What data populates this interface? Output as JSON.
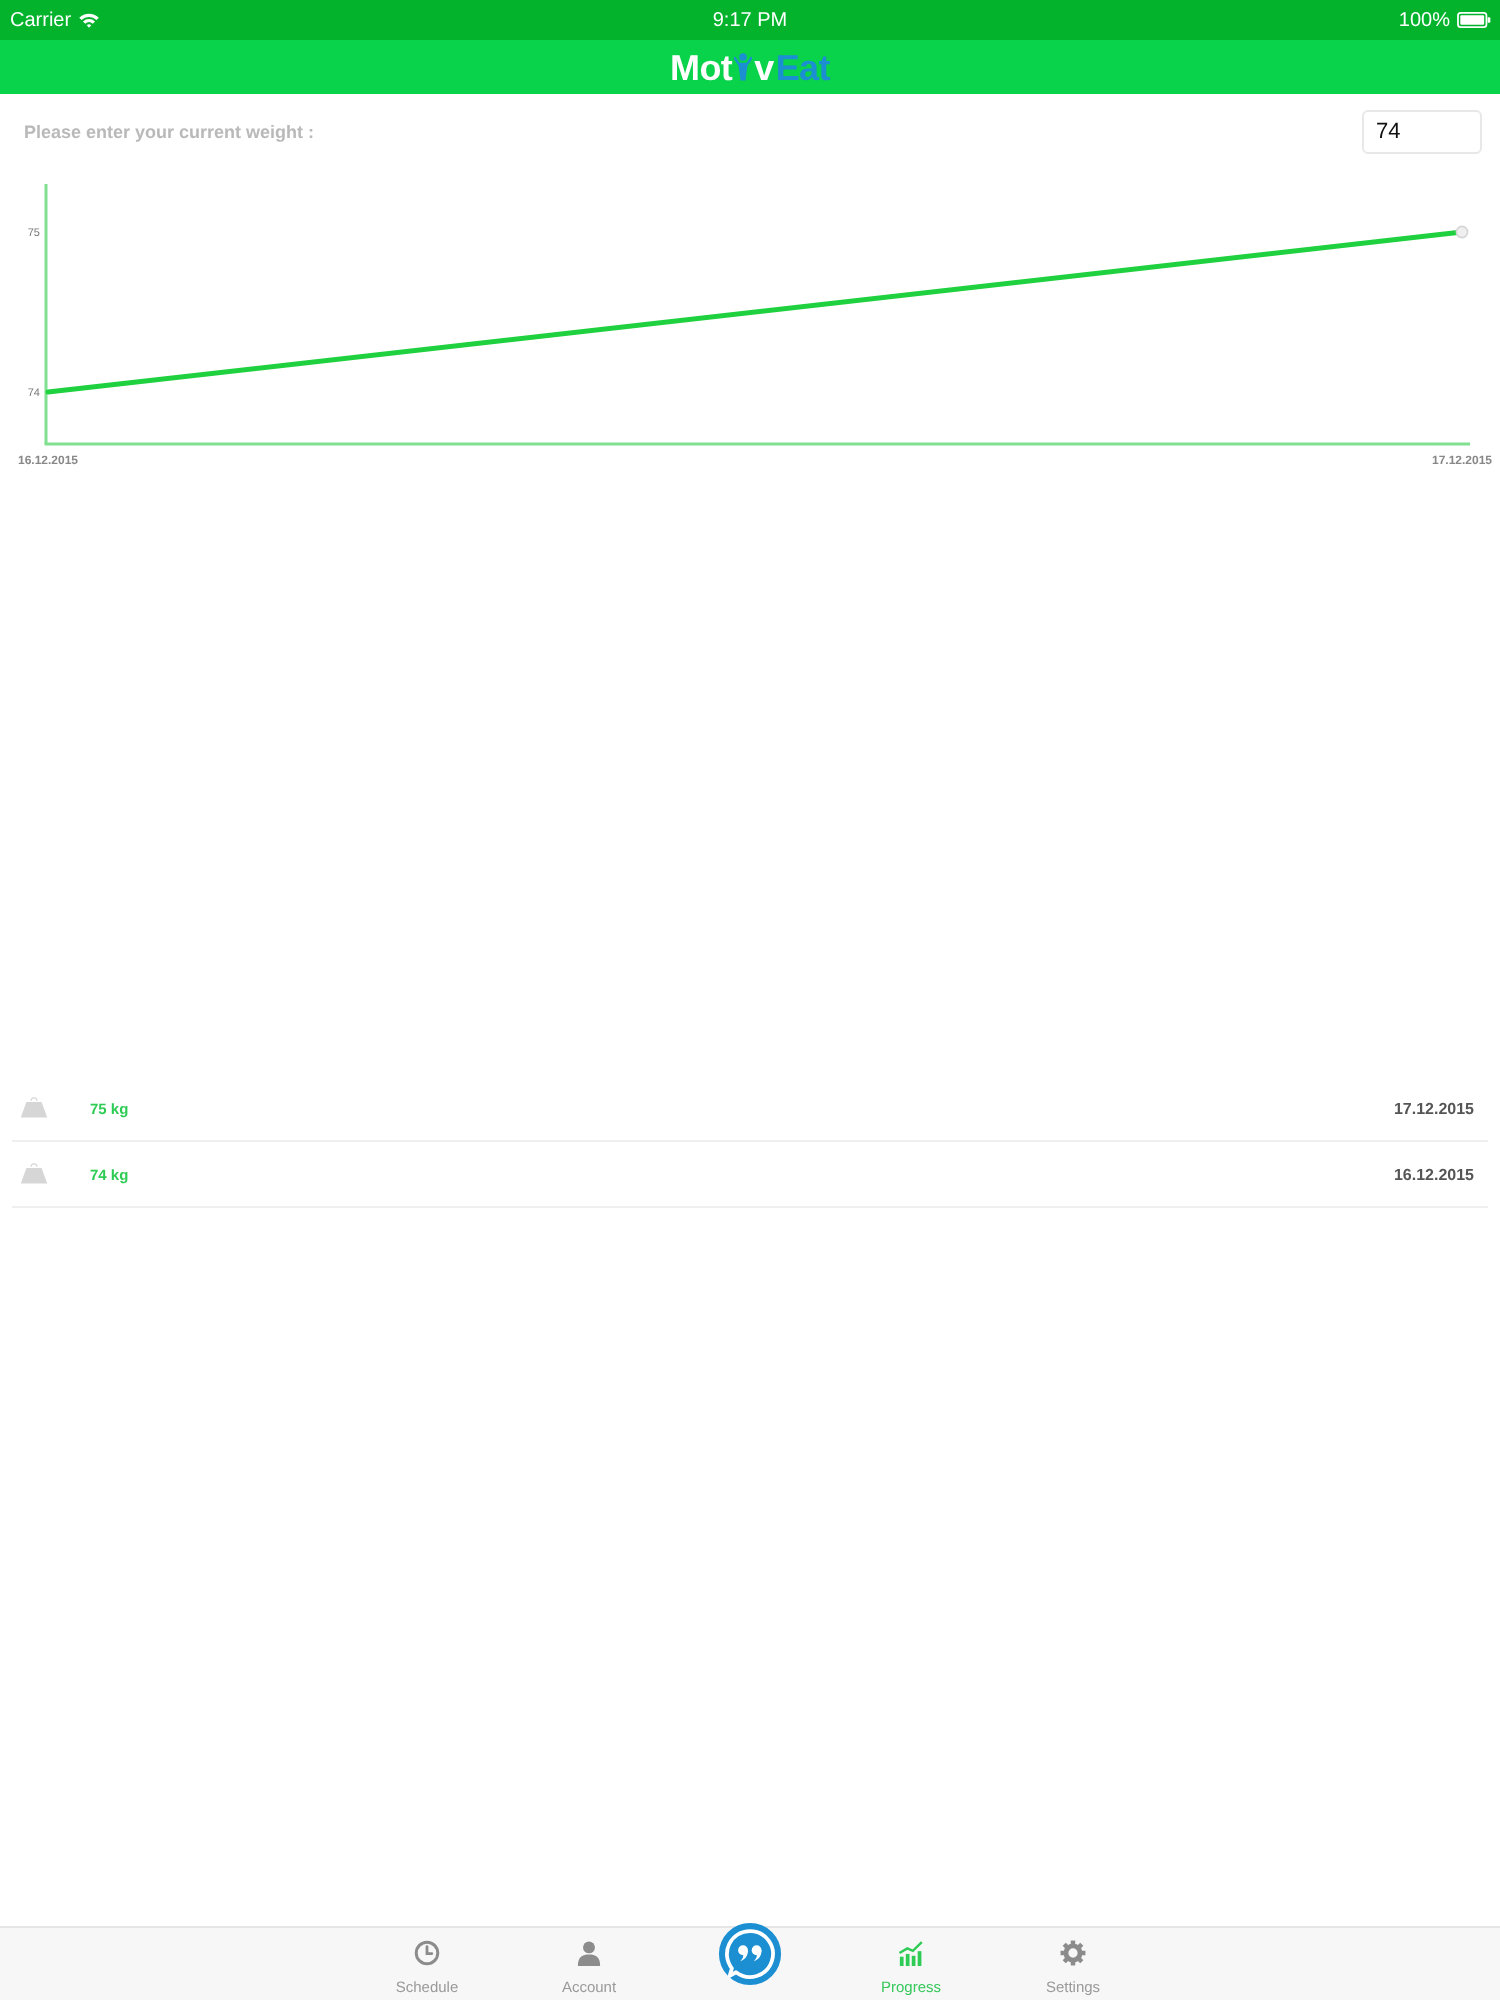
{
  "status_bar": {
    "carrier": "Carrier",
    "time": "9:17 PM",
    "battery": "100%"
  },
  "nav_bar": {
    "logo": {
      "start": "Mot",
      "middle": "v",
      "end": "Eat"
    }
  },
  "weight_form": {
    "label": "Please enter your current weight :",
    "value": "74"
  },
  "progress_chart": {
    "chart_data": {
      "type": "line",
      "categories": [
        "16.12.2015",
        "17.12.2015"
      ],
      "series": [
        {
          "color": "#1fd13f",
          "values": [
            74,
            75
          ]
        }
      ],
      "ylim": [
        73.675,
        75.3
      ],
      "yticks": [
        74,
        75
      ]
    }
  },
  "entries": [
    {
      "weight": "75 kg",
      "date": "17.12.2015"
    },
    {
      "weight": "74 kg",
      "date": "16.12.2015"
    }
  ],
  "tab_bar": {
    "tabs": [
      {
        "kind": "clock",
        "label": "Schedule",
        "selected": false
      },
      {
        "kind": "person",
        "label": "Account",
        "selected": false
      },
      {
        "kind": "chart",
        "label": "Progress",
        "selected": true
      },
      {
        "kind": "gear",
        "label": "Settings",
        "selected": false
      }
    ]
  }
}
